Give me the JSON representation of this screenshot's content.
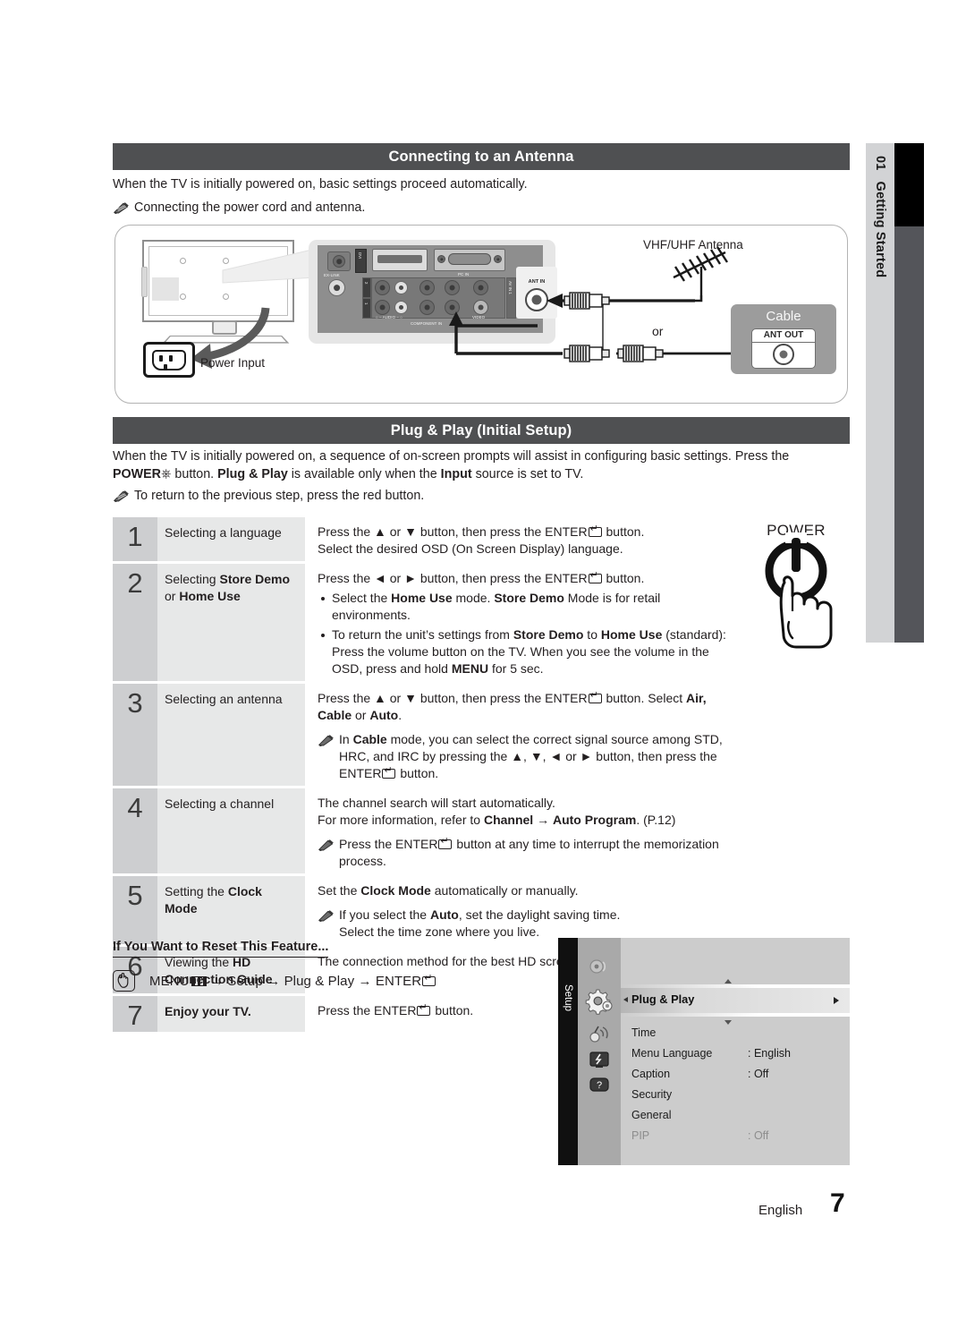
{
  "side_tab": {
    "number": "01",
    "label": "Getting Started"
  },
  "sections": {
    "antenna": {
      "title": "Connecting to an Antenna",
      "intro": "When the TV is initially powered on, basic settings proceed automatically.",
      "note": "Connecting the power cord and antenna.",
      "diagram": {
        "power_input_label": "Power Input",
        "vhf_label": "VHF/UHF Antenna",
        "or_label": "or",
        "cable_label": "Cable",
        "ant_out_label": "ANT OUT",
        "ant_in_label": "ANT IN",
        "panel_labels": {
          "ex_link": "EX-LINK",
          "dvi": "DVI",
          "pc_in": "PC IN",
          "component_in": "COMPONENT IN",
          "audio": "AUDIO",
          "video": "VIDEO",
          "av_in_1": "AV IN 1",
          "row_2": "2",
          "row_1": "1"
        }
      }
    },
    "plugplay": {
      "title": "Plug & Play (Initial Setup)",
      "intro_a": "When the TV is initially powered on, a sequence of on-screen prompts will assist in configuring basic settings. Press the ",
      "intro_power": "POWER",
      "intro_b": " button. ",
      "intro_pp": "Plug & Play",
      "intro_c": " is available only when the ",
      "intro_input": "Input",
      "intro_d": " source is set to TV.",
      "note": "To return to the previous step, press the red button."
    }
  },
  "power_illustration": {
    "label": "POWER"
  },
  "steps": [
    {
      "number": "1",
      "name_plain": "Selecting a language",
      "lines": [
        "Press the ▲ or ▼ button, then press the ENTER button.",
        "Select the desired OSD (On Screen Display) language."
      ]
    },
    {
      "number": "2",
      "name_plain": "Selecting ",
      "name_bold_1": "Store Demo",
      "name_plain_2": "or ",
      "name_bold_2": "Home Use",
      "lead": "Press the ◄ or ► button, then press the ENTER button.",
      "bullet_1_a": "Select the ",
      "bullet_1_b": "Home Use",
      "bullet_1_c": " mode. ",
      "bullet_1_d": "Store Demo",
      "bullet_1_e": " Mode is for retail environments.",
      "bullet_2_a": "To return the unit’s settings from ",
      "bullet_2_b": "Store Demo",
      "bullet_2_c": " to ",
      "bullet_2_d": "Home Use",
      "bullet_2_e": " (standard): Press the volume button on the TV. When you see the volume in the OSD, press and hold ",
      "bullet_2_f": "MENU",
      "bullet_2_g": " for 5 sec."
    },
    {
      "number": "3",
      "name_plain": "Selecting an antenna",
      "lead_a": "Press the ▲ or ▼ button, then press the ENTER button. Select ",
      "lead_b": "Air, Cable",
      "lead_c": " or ",
      "lead_d": "Auto",
      "lead_e": ".",
      "note_a": "In ",
      "note_b": "Cable",
      "note_c": " mode, you can select the correct signal source among STD, HRC, and IRC by pressing the ▲, ▼, ◄ or ► button, then press the ENTER button."
    },
    {
      "number": "4",
      "name_plain": "Selecting a channel",
      "line_1": "The channel search will start automatically.",
      "line_2_a": "For more information, refer to ",
      "line_2_b": "Channel",
      "line_2_c": " → ",
      "line_2_d": "Auto Program",
      "line_2_e": ". (P.12)",
      "note": "Press the ENTER button at any time to interrupt the memorization process."
    },
    {
      "number": "5",
      "name_plain": "Setting the ",
      "name_bold": "Clock Mode",
      "lead_a": "Set the ",
      "lead_b": "Clock Mode",
      "lead_c": " automatically or manually.",
      "note_a": "If you select the ",
      "note_b": "Auto",
      "note_c": ", set the daylight saving time.",
      "note_d": "Select the time zone where you live."
    },
    {
      "number": "6",
      "name_plain": "Viewing the ",
      "name_bold": "HD Connection Guide",
      "line": "The connection method for the best HD screen quality is displayed."
    },
    {
      "number": "7",
      "name_bold": "Enjoy your TV.",
      "line": "Press the ENTER button."
    }
  ],
  "reset": {
    "title": "If You Want to Reset This Feature...",
    "menu": "MENU",
    "arrow_1": " → ",
    "setup": "Setup",
    "arrow_2": " → ",
    "plugplay": "Plug & Play",
    "arrow_3": " → ",
    "enter": "ENTER"
  },
  "osd": {
    "title": "Setup",
    "highlight": "Plug & Play",
    "items": [
      {
        "label": "Time",
        "value": ""
      },
      {
        "label": "Menu Language",
        "value": ": English"
      },
      {
        "label": "Caption",
        "value": ": Off"
      },
      {
        "label": "Security",
        "value": ""
      },
      {
        "label": "General",
        "value": ""
      },
      {
        "label": "PIP",
        "value": ": Off"
      }
    ]
  },
  "footer": {
    "language": "English",
    "page": "7"
  },
  "colors": {
    "section_bar": "#4f5052",
    "step_number_bg": "#cdced0",
    "step_name_bg": "#e7e8e8",
    "side_tab_bg": "#d2d3d5"
  }
}
